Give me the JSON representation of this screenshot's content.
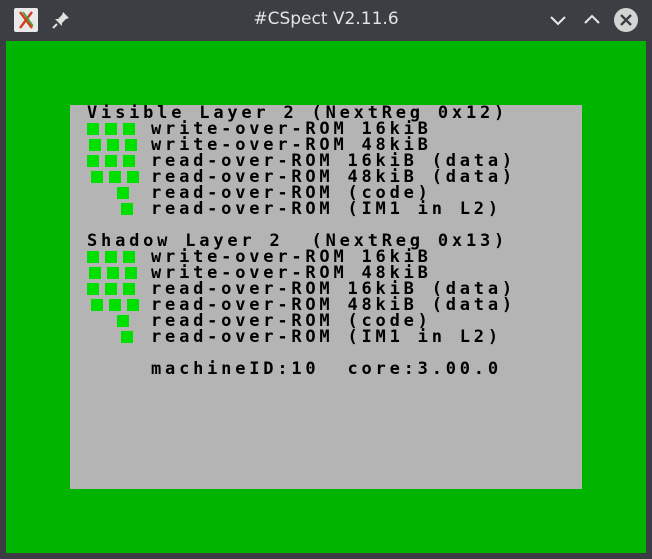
{
  "window": {
    "title": "#CSpect V2.11.6",
    "icons": {
      "app": "cspect-app-icon",
      "pin": "pin-icon",
      "minimize": "chevron-down-icon",
      "maximize": "chevron-up-icon",
      "close": "close-icon"
    }
  },
  "colors": {
    "border": "#00b400",
    "paper": "#b4b4b4",
    "ink": "#000000",
    "indicator": "#00e000"
  },
  "visible_layer": {
    "header": "Visible Layer 2 (NextReg 0x12)",
    "rows": [
      {
        "label": "write-over-ROM 16kiB"
      },
      {
        "label": "write-over-ROM 48kiB"
      },
      {
        "label": "read-over-ROM 16kiB (data)"
      },
      {
        "label": "read-over-ROM 48kiB (data)"
      },
      {
        "label": "read-over-ROM (code)"
      },
      {
        "label": "read-over-ROM (IM1 in L2)"
      }
    ]
  },
  "shadow_layer": {
    "header": "Shadow Layer 2  (NextReg 0x13)",
    "rows": [
      {
        "label": "write-over-ROM 16kiB"
      },
      {
        "label": "write-over-ROM 48kiB"
      },
      {
        "label": "read-over-ROM 16kiB (data)"
      },
      {
        "label": "read-over-ROM 48kiB (data)"
      },
      {
        "label": "read-over-ROM (code)"
      },
      {
        "label": "read-over-ROM (IM1 in L2)"
      }
    ]
  },
  "machine_info": "machineID:10  core:3.00.0"
}
